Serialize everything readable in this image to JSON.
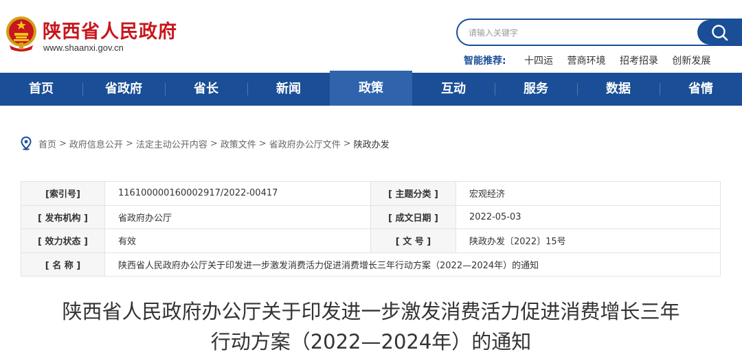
{
  "site": {
    "title": "陕西省人民政府",
    "url": "www.shaanxi.gov.cn"
  },
  "search": {
    "placeholder": "请输入关键字"
  },
  "smart": {
    "label": "智能推荐:",
    "links": [
      "十四运",
      "营商环境",
      "招考招录",
      "创新发展"
    ]
  },
  "nav": {
    "items": [
      "首页",
      "省政府",
      "省长",
      "新闻",
      "政策",
      "互动",
      "服务",
      "数据",
      "省情"
    ],
    "active": "政策"
  },
  "breadcrumb": [
    "首页",
    "政府信息公开",
    "法定主动公开内容",
    "政策文件",
    "省政府办公厅文件",
    "陕政办发"
  ],
  "info": {
    "index_label": "[索引号]",
    "index_value": "116100000160002917/2022-00417",
    "topic_label": "[ 主题分类 ]",
    "topic_value": "宏观经济",
    "issuer_label": "[ 发布机构 ]",
    "issuer_value": "省政府办公厅",
    "date_label": "[ 成文日期 ]",
    "date_value": "2022-05-03",
    "status_label": "[ 效力状态 ]",
    "status_value": "有效",
    "docno_label": "[ 文 号 ]",
    "docno_value": "陕政办发〔2022〕15号",
    "name_label": "[ 名 称 ]",
    "name_value": "陕西省人民政府办公厅关于印发进一步激发消费活力促进消费增长三年行动方案（2022—2024年）的通知"
  },
  "article": {
    "title": "陕西省人民政府办公厅关于印发进一步激发消费活力促进消费增长三年行动方案（2022—2024年）的通知"
  },
  "colors": {
    "brand_red": "#c8161d",
    "nav_blue": "#1a4e96",
    "nav_active": "#2f64ad"
  }
}
